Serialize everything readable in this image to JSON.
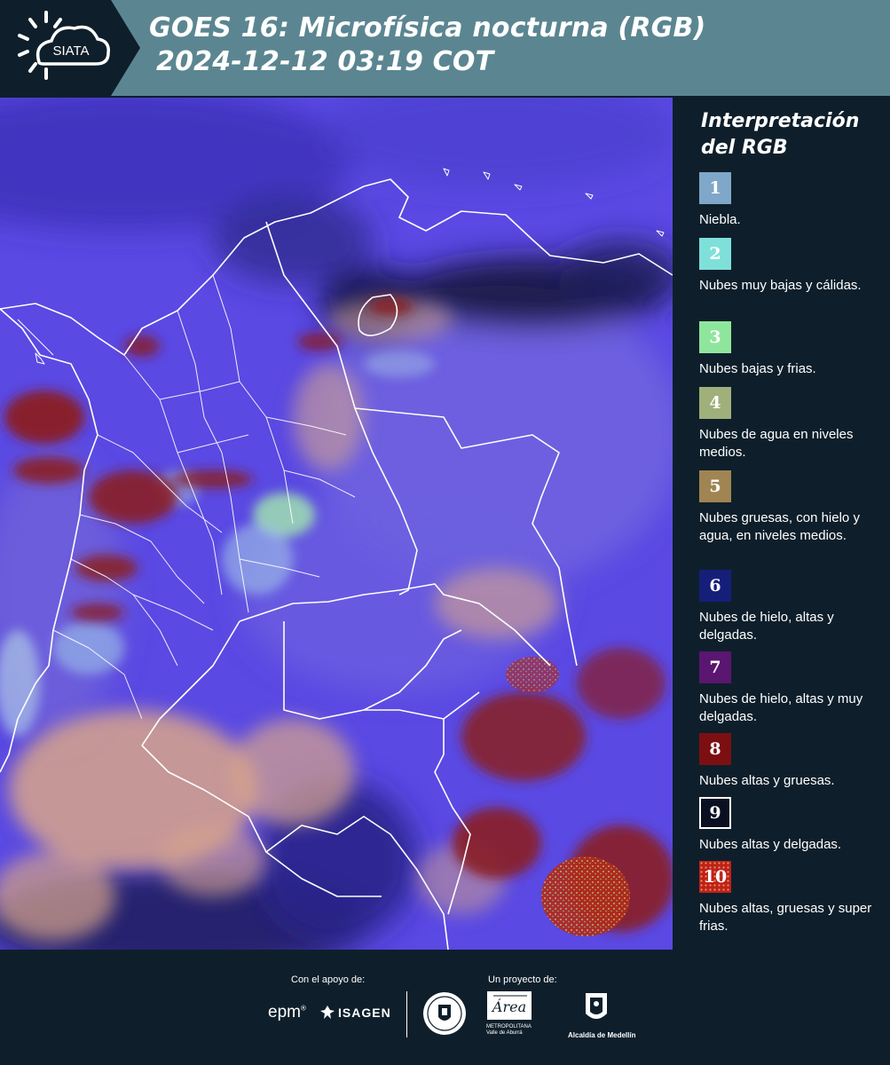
{
  "header": {
    "logo_text": "SIATA",
    "title_line1": "GOES 16: Microfísica nocturna (RGB)",
    "title_line2": "2024-12-12 03:19 COT"
  },
  "legend": {
    "title_line1": "Interpretación",
    "title_line2": "del RGB",
    "items": [
      {
        "num": "1",
        "color": "#7fa7c9",
        "text": "Niebla."
      },
      {
        "num": "2",
        "color": "#7fe0da",
        "text": "Nubes muy bajas y cálidas."
      },
      {
        "num": "3",
        "color": "#8ee69c",
        "text": "Nubes bajas y frias."
      },
      {
        "num": "4",
        "color": "#9fb07a",
        "text": "Nubes de agua en niveles medios."
      },
      {
        "num": "5",
        "color": "#a08553",
        "text": "Nubes gruesas, con hielo y agua, en niveles medios."
      },
      {
        "num": "6",
        "color": "#151f7a",
        "text": "Nubes de hielo, altas y delgadas."
      },
      {
        "num": "7",
        "color": "#5a1670",
        "text": "Nubes de hielo, altas y muy delgadas."
      },
      {
        "num": "8",
        "color": "#7c0f12",
        "text": "Nubes altas y gruesas."
      },
      {
        "num": "9",
        "color": "#0a0f22",
        "text": "Nubes altas y delgadas."
      },
      {
        "num": "10",
        "color": "#c0201c",
        "text": "Nubes altas, gruesas y super frias."
      }
    ]
  },
  "footer": {
    "support_label": "Con el apoyo de:",
    "project_label": "Un proyecto de:",
    "epm": "epm",
    "isagen": "ISAGEN",
    "area_name": "Área",
    "area_sub1": "METROPOLITANA",
    "area_sub2": "Valle de Aburrá",
    "alcaldia": "Alcaldía de Medellín"
  },
  "map": {
    "background_color": "#5a49e3",
    "description_icon": "satellite-image"
  }
}
